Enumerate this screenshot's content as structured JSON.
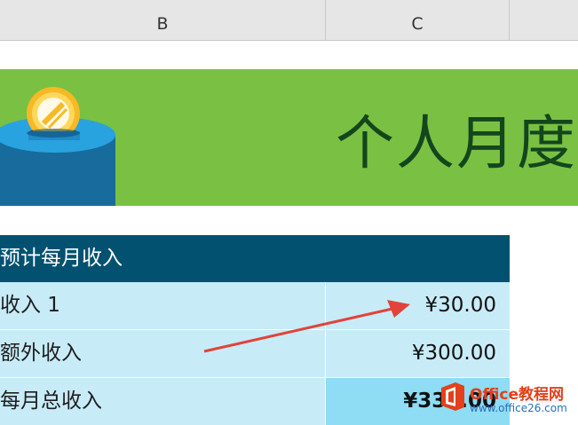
{
  "columns": [
    "B",
    "C"
  ],
  "banner": {
    "title": "个人月度"
  },
  "table": {
    "header": "预计每月收入",
    "rows": [
      {
        "label": "收入 1",
        "value": "¥30.00"
      },
      {
        "label": "额外收入",
        "value": "¥300.00"
      },
      {
        "label": "每月总收入",
        "value": "¥330.00"
      }
    ]
  },
  "watermark": {
    "line1": "Office教程网",
    "line2": "www.office26.com"
  },
  "colors": {
    "banner_bg": "#7ac143",
    "title_color": "#14461d",
    "table_header_bg": "#035170",
    "row_bg": "#c8ebf8",
    "total_bg": "#8fdcf5",
    "arrow": "#e0443a"
  }
}
